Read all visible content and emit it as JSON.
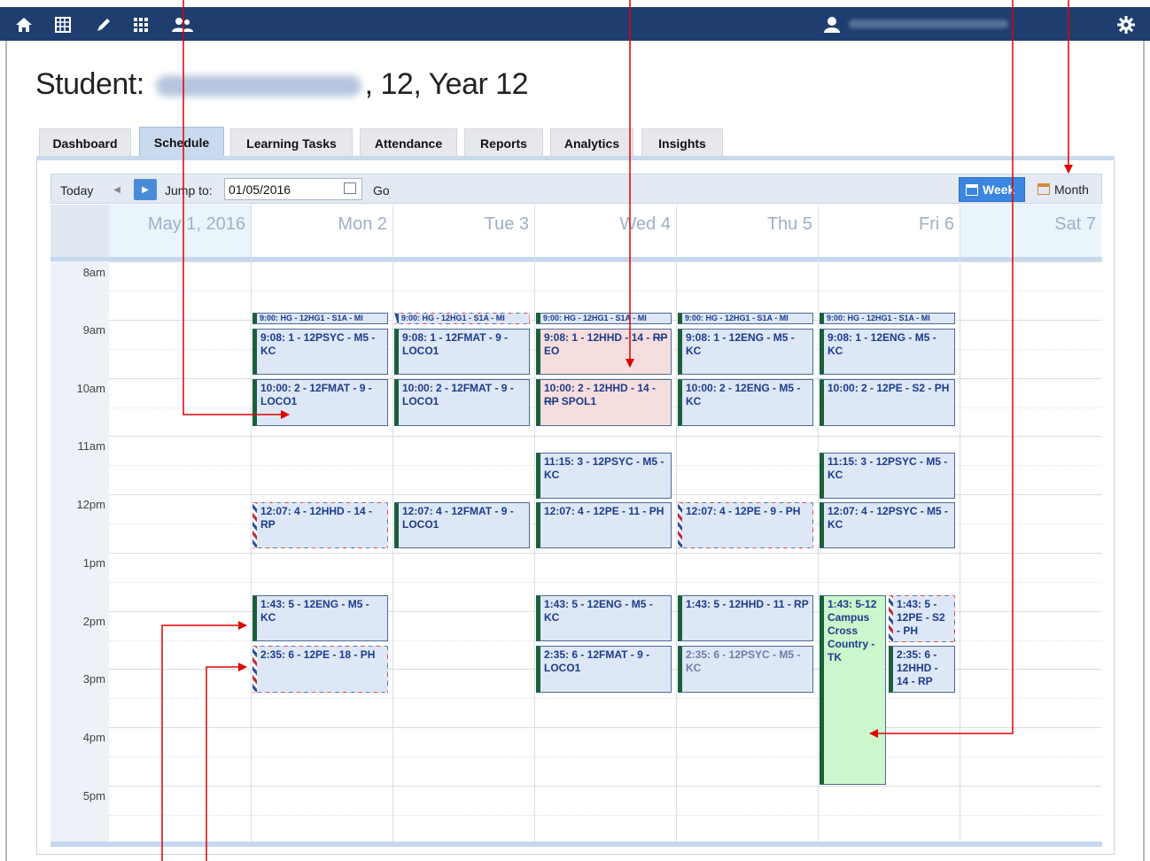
{
  "topbar": {
    "icons": [
      "home-icon",
      "calendar-grid-icon",
      "pencil-icon",
      "apps-grid-icon",
      "people-icon"
    ],
    "right_icons": [
      "user-icon",
      "gear-icon"
    ]
  },
  "student": {
    "prefix": "Student:",
    "suffix": ", 12, Year 12"
  },
  "tabs": [
    "Dashboard",
    "Schedule",
    "Learning Tasks",
    "Attendance",
    "Reports",
    "Analytics",
    "Insights"
  ],
  "active_tab": "Schedule",
  "toolbar": {
    "today": "Today",
    "jump_to": "Jump to:",
    "date_value": "01/05/2016",
    "go": "Go",
    "week": "Week",
    "month": "Month"
  },
  "days": [
    "May 1, 2016",
    "Mon 2",
    "Tue 3",
    "Wed 4",
    "Thu 5",
    "Fri 6",
    "Sat 7"
  ],
  "hours": [
    "8am",
    "9am",
    "10am",
    "11am",
    "12pm",
    "1pm",
    "2pm",
    "3pm",
    "4pm",
    "5pm"
  ],
  "events": {
    "mon": {
      "hg": "9:00: HG - 12HG1 - S1A - MI",
      "p1": "9:08: 1 - 12PSYC - M5 - KC",
      "p2": "10:00: 2 - 12FMAT - 9 - LOCO1",
      "p4": "12:07: 4 - 12HHD - 14 - RP",
      "p5": "1:43: 5 - 12ENG - M5 - KC",
      "p6": "2:35: 6 - 12PE - 18 - PH"
    },
    "tue": {
      "hg": "9:00: HG - 12HG1 - S1A - MI",
      "p1": "9:08: 1 - 12FMAT - 9 - LOCO1",
      "p2": "10:00: 2 - 12FMAT - 9 - LOCO1",
      "p4": "12:07: 4 - 12FMAT - 9 - LOCO1"
    },
    "wed": {
      "hg": "9:00: HG - 12HG1 - S1A - MI",
      "p1_a": "9:08: 1 - 12HHD - 14 -",
      "p1_strike": "RP",
      "p1_b": "EO",
      "p2_a": "10:00: 2 - 12HHD - 14 -",
      "p2_strike": "RP",
      "p2_b": "SPOL1",
      "p3": "11:15: 3 - 12PSYC - M5 - KC",
      "p4": "12:07: 4 - 12PE - 11 - PH",
      "p5": "1:43: 5 - 12ENG - M5 - KC",
      "p6": "2:35: 6 - 12FMAT - 9 - LOCO1"
    },
    "thu": {
      "hg": "9:00: HG - 12HG1 - S1A - MI",
      "p1": "9:08: 1 - 12ENG - M5 - KC",
      "p2": "10:00: 2 - 12ENG - M5 - KC",
      "p4": "12:07: 4 - 12PE - 9 - PH",
      "p5": "1:43: 5 - 12HHD - 11 - RP",
      "p6": "2:35: 6 - 12PSYC - M5 - KC"
    },
    "fri": {
      "hg": "9:00: HG - 12HG1 - S1A - MI",
      "p1": "9:08: 1 - 12ENG - M5 - KC",
      "p2": "10:00: 2 - 12PE - S2 - PH",
      "p3": "11:15: 3 - 12PSYC - M5 - KC",
      "p4": "12:07: 4 - 12PSYC - M5 - KC",
      "xc": "1:43: 5-12 Campus Cross Country - TK",
      "p5": "1:43: 5 - 12PE - S2 - PH",
      "p6": "2:35: 6 - 12HHD - 14 - RP"
    }
  },
  "colors": {
    "nav": "#1f3e6f",
    "event_blue": "#dde7f5",
    "event_pink": "#f7dede",
    "event_green": "#ccf7cc",
    "annotation": "#e00000"
  }
}
